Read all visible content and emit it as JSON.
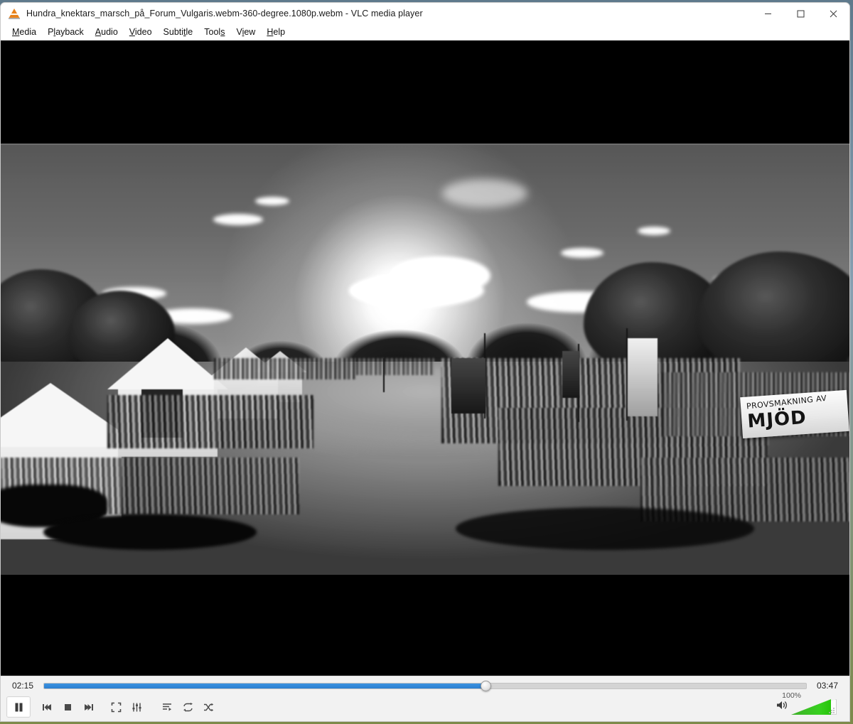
{
  "window": {
    "title": "Hundra_knektars_marsch_på_Forum_Vulgaris.webm-360-degree.1080p.webm - VLC media player",
    "app_icon": "vlc-cone-icon",
    "controls": {
      "minimize": "minimize-icon",
      "maximize": "maximize-icon",
      "close": "close-icon"
    }
  },
  "menubar": {
    "items": [
      {
        "pre": "",
        "mn": "M",
        "post": "edia"
      },
      {
        "pre": "P",
        "mn": "l",
        "post": "ayback"
      },
      {
        "pre": "",
        "mn": "A",
        "post": "udio"
      },
      {
        "pre": "",
        "mn": "V",
        "post": "ideo"
      },
      {
        "pre": "Subti",
        "mn": "t",
        "post": "le"
      },
      {
        "pre": "Tool",
        "mn": "s",
        "post": ""
      },
      {
        "pre": "V",
        "mn": "i",
        "post": "ew"
      },
      {
        "pre": "",
        "mn": "H",
        "post": "elp"
      }
    ]
  },
  "video": {
    "description": "360-degree equirectangular grayscale footage of a historical reenactment march with crowds, medieval tents, trees, banners and bright sun",
    "banner": {
      "line1": "PROVSMAKNING AV",
      "line2": "MJÖD"
    }
  },
  "playback": {
    "elapsed": "02:15",
    "total": "03:47",
    "progress_percent": 58,
    "state": "playing",
    "accent_color": "#2b7fd0"
  },
  "buttons": {
    "play_pause": "pause-icon",
    "previous": "previous-icon",
    "stop": "stop-icon",
    "next": "next-icon",
    "fullscreen": "fullscreen-icon",
    "extended_settings": "equalizer-icon",
    "playlist": "playlist-icon",
    "loop": "loop-icon",
    "random": "shuffle-icon"
  },
  "volume": {
    "label": "100%",
    "level_percent": 100,
    "icon": "speaker-icon",
    "color": "#35c217"
  }
}
